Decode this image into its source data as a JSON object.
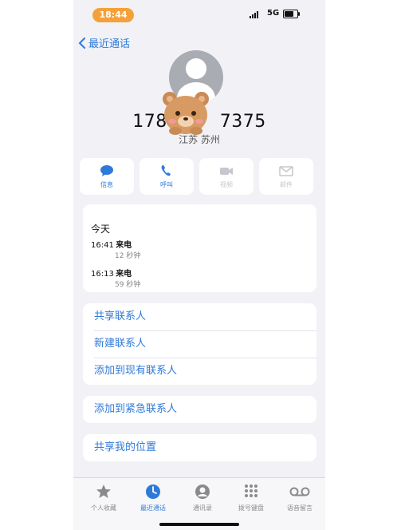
{
  "status_bar": {
    "time": "18:44",
    "network": "5G"
  },
  "nav": {
    "back_label": "最近通话"
  },
  "contact": {
    "number_prefix": "178",
    "number_suffix": "7375",
    "location": "江苏 苏州"
  },
  "actions": [
    {
      "label": "信息",
      "icon": "message-bubble-icon",
      "enabled": true
    },
    {
      "label": "呼叫",
      "icon": "phone-icon",
      "enabled": true
    },
    {
      "label": "视频",
      "icon": "video-camera-icon",
      "enabled": false
    },
    {
      "label": "邮件",
      "icon": "mail-icon",
      "enabled": false
    }
  ],
  "recents": {
    "day_label": "今天",
    "calls": [
      {
        "time": "16:41",
        "type": "来电",
        "duration": "12 秒钟"
      },
      {
        "time": "16:13",
        "type": "来电",
        "duration": "59 秒钟"
      }
    ]
  },
  "menu_group_1": [
    "共享联系人",
    "新建联系人",
    "添加到现有联系人"
  ],
  "menu_group_2": [
    "添加到紧急联系人"
  ],
  "menu_group_3": [
    "共享我的位置"
  ],
  "tabbar": {
    "tabs": [
      {
        "label": "个人收藏",
        "icon": "star-icon"
      },
      {
        "label": "最近通话",
        "icon": "clock-icon",
        "active": true
      },
      {
        "label": "通讯录",
        "icon": "person-circle-icon"
      },
      {
        "label": "拨号键盘",
        "icon": "keypad-icon"
      },
      {
        "label": "语音留言",
        "icon": "voicemail-icon"
      }
    ]
  },
  "colors": {
    "accent": "#2f7ad9",
    "time_pill": "#f5a13a",
    "background": "#f1f1f6"
  }
}
